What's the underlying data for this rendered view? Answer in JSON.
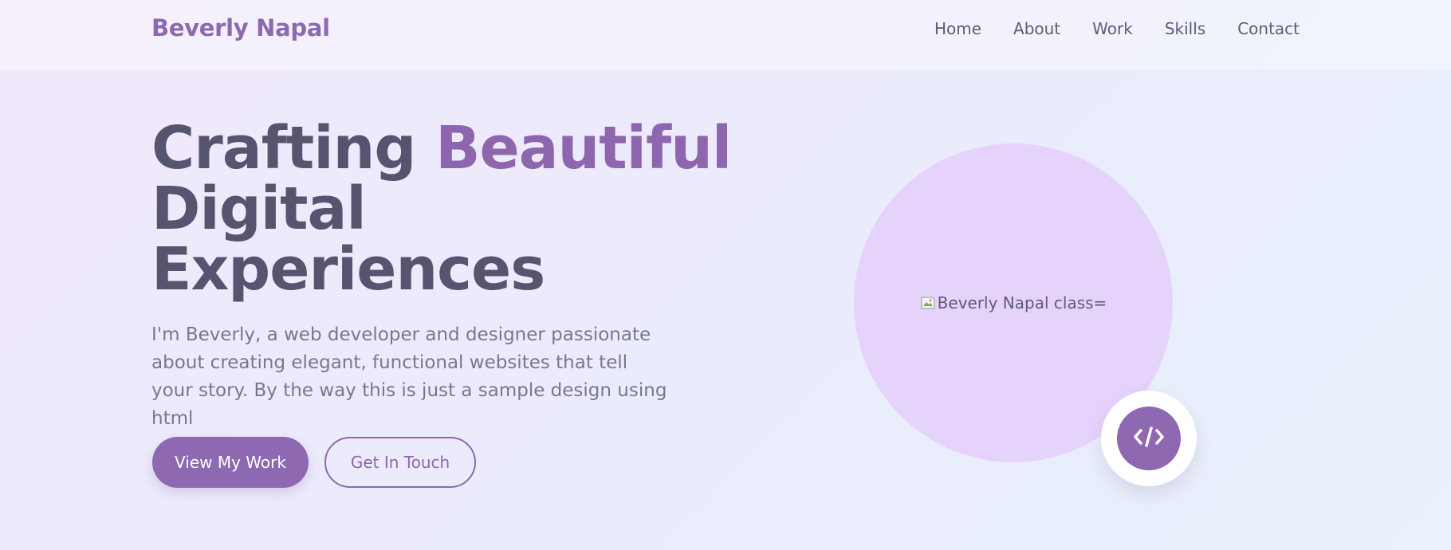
{
  "header": {
    "brand": "Beverly Napal",
    "nav": [
      {
        "label": "Home"
      },
      {
        "label": "About"
      },
      {
        "label": "Work"
      },
      {
        "label": "Skills"
      },
      {
        "label": "Contact"
      }
    ]
  },
  "hero": {
    "title_part1": "Crafting ",
    "title_accent": "Beautiful",
    "title_line2": "Digital",
    "title_line3": "Experiences",
    "description": "I'm Beverly, a web developer and designer passionate about creating elegant, functional websites that tell your story. By the way this is just a sample design using html",
    "primary_button": "View My Work",
    "secondary_button": "Get In Touch"
  },
  "portrait": {
    "alt_text": "Beverly Napal class=",
    "badge_icon": "code-icon"
  },
  "colors": {
    "accent": "#8e68b0",
    "heading": "#575470",
    "body_text": "#7a778d",
    "portrait_bg": "#e5d3fc"
  }
}
